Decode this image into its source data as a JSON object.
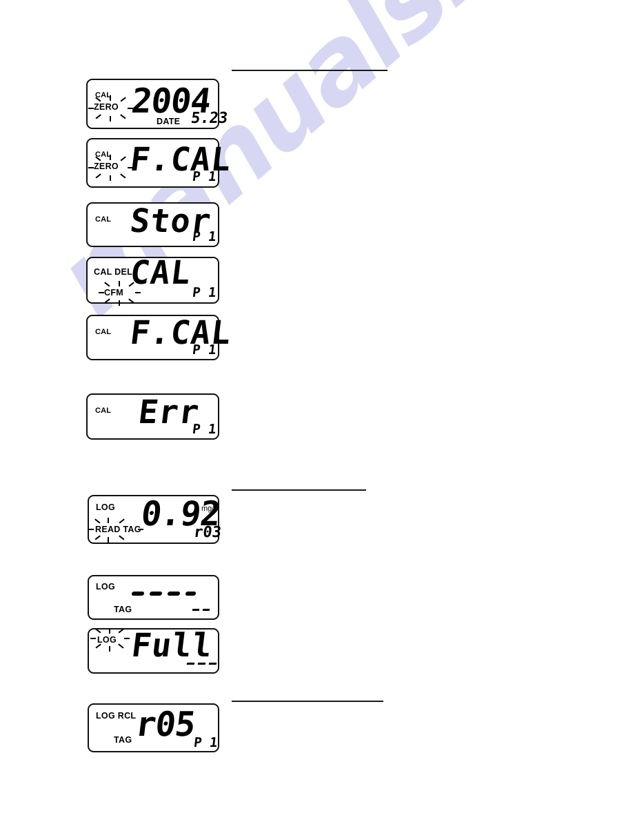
{
  "page": {
    "watermark": "manualshive.com",
    "background_color": "#ffffff",
    "ink_color": "#000000",
    "watermark_color": "#c9c9ef"
  },
  "rules": [
    {
      "name": "section-rule-top",
      "label": "horizontal rule"
    },
    {
      "name": "section-rule-middle",
      "label": "horizontal rule"
    },
    {
      "name": "section-rule-bottom",
      "label": "horizontal rule"
    }
  ],
  "displays": [
    {
      "id": "display-year-date",
      "annunciators": [
        "CAL",
        "ZERO"
      ],
      "blinking": "ZERO",
      "main": "2004",
      "sub_label": "DATE",
      "sub_value": "5.23",
      "unit": "",
      "corner": ""
    },
    {
      "id": "display-fcal-p1",
      "annunciators": [
        "CAL",
        "ZERO"
      ],
      "blinking": "ZERO",
      "main": "F.CAL",
      "sub_label": "",
      "sub_value": "",
      "unit": "",
      "corner": "P 1"
    },
    {
      "id": "display-stor-p1",
      "annunciators": [
        "CAL"
      ],
      "blinking": "",
      "main": "Stor",
      "sub_label": "",
      "sub_value": "",
      "unit": "",
      "corner": "P 1"
    },
    {
      "id": "display-cal-del-cfm",
      "annunciators": [
        "CAL DEL",
        "CFM"
      ],
      "blinking": "CFM",
      "main": "CAL",
      "sub_label": "",
      "sub_value": "",
      "unit": "",
      "corner": "P 1"
    },
    {
      "id": "display-fcal-confirm",
      "annunciators": [
        "CAL"
      ],
      "blinking": "",
      "main": "F.CAL",
      "sub_label": "",
      "sub_value": "",
      "unit": "",
      "corner": "P 1"
    },
    {
      "id": "display-error",
      "annunciators": [
        "CAL"
      ],
      "blinking": "",
      "main": "Err",
      "sub_label": "",
      "sub_value": "",
      "unit": "",
      "corner": "P 1"
    },
    {
      "id": "display-log-reading",
      "annunciators": [
        "LOG",
        "READ TAG"
      ],
      "blinking": "READ TAG",
      "main": "0.92",
      "sub_label": "",
      "sub_value": "",
      "unit": "mg/l",
      "corner": "r03"
    },
    {
      "id": "display-log-tag-blank",
      "annunciators": [
        "LOG",
        "TAG"
      ],
      "blinking": "",
      "main": "- - - -",
      "sub_label": "",
      "sub_value": "",
      "unit": "",
      "corner": "- -"
    },
    {
      "id": "display-log-full",
      "annunciators": [
        "LOG"
      ],
      "blinking": "LOG",
      "main": "Full",
      "sub_label": "",
      "sub_value": "",
      "unit": "",
      "corner": "- - -"
    },
    {
      "id": "display-log-rcl-r05",
      "annunciators": [
        "LOG RCL",
        "TAG"
      ],
      "blinking": "",
      "main": "r05",
      "sub_label": "",
      "sub_value": "",
      "unit": "",
      "corner": "P 1"
    }
  ]
}
